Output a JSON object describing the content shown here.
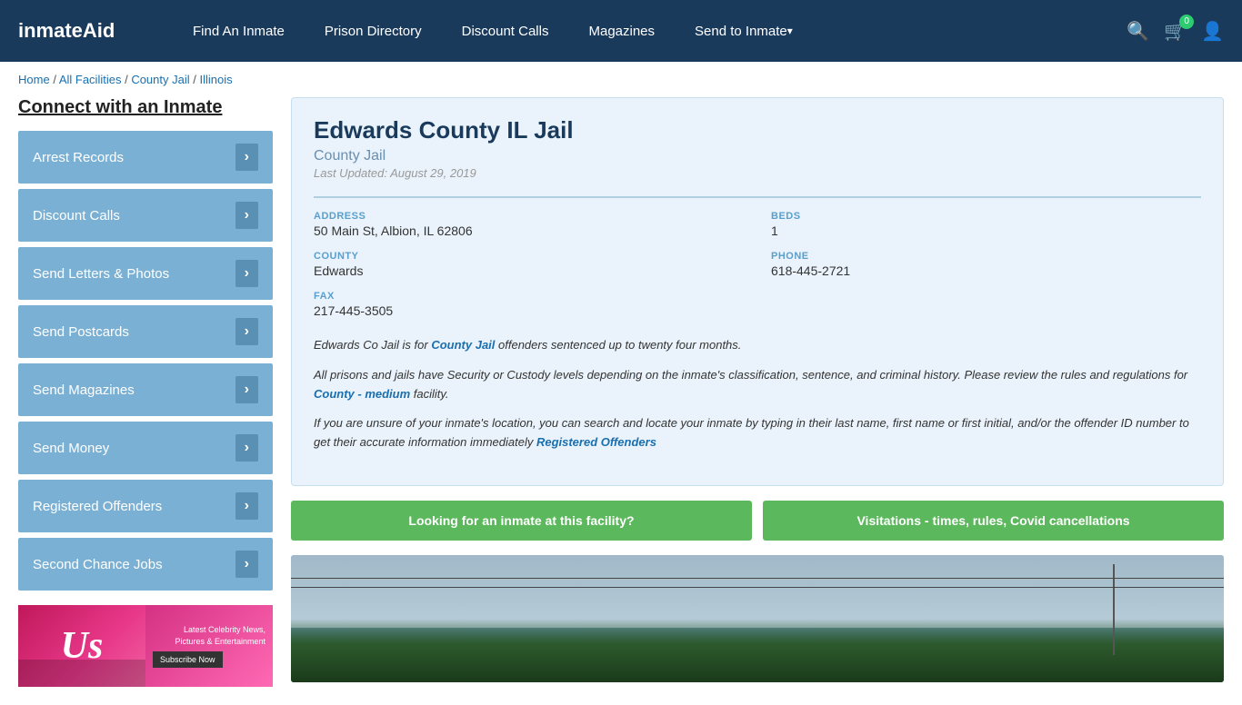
{
  "header": {
    "logo_text": "inmateAid",
    "nav_items": [
      {
        "label": "Find An Inmate",
        "dropdown": false
      },
      {
        "label": "Prison Directory",
        "dropdown": false
      },
      {
        "label": "Discount Calls",
        "dropdown": false
      },
      {
        "label": "Magazines",
        "dropdown": false
      },
      {
        "label": "Send to Inmate",
        "dropdown": true
      }
    ],
    "cart_count": "0"
  },
  "breadcrumb": {
    "items": [
      "Home",
      "All Facilities",
      "County Jail",
      "Illinois"
    ]
  },
  "sidebar": {
    "title": "Connect with an Inmate",
    "items": [
      "Arrest Records",
      "Discount Calls",
      "Send Letters & Photos",
      "Send Postcards",
      "Send Magazines",
      "Send Money",
      "Registered Offenders",
      "Second Chance Jobs"
    ]
  },
  "facility": {
    "name": "Edwards County IL Jail",
    "type": "County Jail",
    "last_updated": "Last Updated: August 29, 2019",
    "address_label": "ADDRESS",
    "address_value": "50 Main St, Albion, IL 62806",
    "beds_label": "BEDS",
    "beds_value": "1",
    "county_label": "COUNTY",
    "county_value": "Edwards",
    "phone_label": "PHONE",
    "phone_value": "618-445-2721",
    "fax_label": "FAX",
    "fax_value": "217-445-3505",
    "desc1": "Edwards Co Jail is for County Jail offenders sentenced up to twenty four months.",
    "desc2": "All prisons and jails have Security or Custody levels depending on the inmate's classification, sentence, and criminal history. Please review the rules and regulations for County - medium facility.",
    "desc3": "If you are unsure of your inmate's location, you can search and locate your inmate by typing in their last name, first name or first initial, and/or the offender ID number to get their accurate information immediately Registered Offenders",
    "btn1": "Looking for an inmate at this facility?",
    "btn2": "Visitations - times, rules, Covid cancellations"
  },
  "ad": {
    "logo": "Us",
    "text": "Latest Celebrity News, Pictures & Entertainment",
    "button": "Subscribe Now"
  }
}
